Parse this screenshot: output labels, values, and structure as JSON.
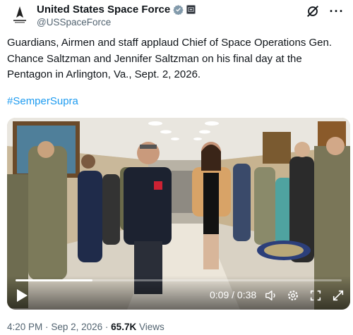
{
  "account": {
    "display_name": "United States Space Force",
    "handle": "@USSpaceForce"
  },
  "tweet": {
    "text": "Guardians, Airmen and staff applaud Chief of Space Operations Gen. Chance Saltzman and Jennifer Saltzman on his final day at the Pentagon in Arlington, Va., Sept. 2, 2026.",
    "hashtag": "#SemperSupra"
  },
  "video": {
    "time_display": "0:09 / 0:38",
    "progress": 0.237
  },
  "meta": {
    "time": "4:20 PM",
    "separator": "·",
    "date": "Sep 2, 2026",
    "views_count": "65.7K",
    "views_label": "Views"
  },
  "colors": {
    "link": "#1d9bf0",
    "secondary_text": "#536471",
    "verified_badge": "#829aab"
  },
  "icons": [
    "space-force-logo-icon",
    "verified-badge-icon",
    "affiliation-badge-icon",
    "grok-icon",
    "more-icon",
    "play-icon",
    "volume-icon",
    "settings-icon",
    "fullscreen-icon",
    "expand-icon"
  ]
}
